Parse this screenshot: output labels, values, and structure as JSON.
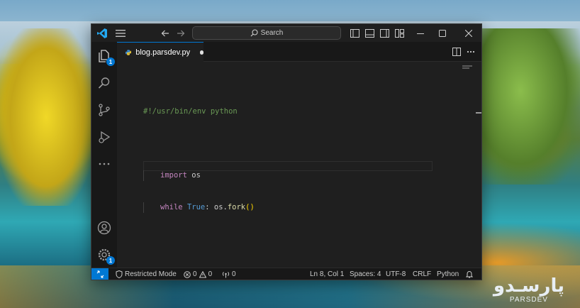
{
  "editor": {
    "tab_label": "blog.parsdev.py",
    "search_placeholder": "Search",
    "code": {
      "shebang": "#!/usr/bin/env python",
      "import_kw": "import",
      "import_mod": " os",
      "while_kw": "while",
      "true_kw": "True",
      "colon": ": os.",
      "fork_fn": "fork",
      "parens": "()"
    }
  },
  "activity": {
    "explorer_badge": "1",
    "settings_badge": "1"
  },
  "status": {
    "restricted_mode": "Restricted Mode",
    "errors": "0",
    "warnings": "0",
    "ports": "0",
    "position": "Ln 8, Col 1",
    "spaces": "Spaces: 4",
    "encoding": "UTF-8",
    "eol": "CRLF",
    "language": "Python"
  },
  "watermark": {
    "logo_text": "پارسـدو",
    "brand": "PARSDEV"
  },
  "colors": {
    "accent": "#0078d4",
    "editor_bg": "#1f1f1f",
    "keyword": "#c586c0",
    "comment": "#6a9955"
  }
}
